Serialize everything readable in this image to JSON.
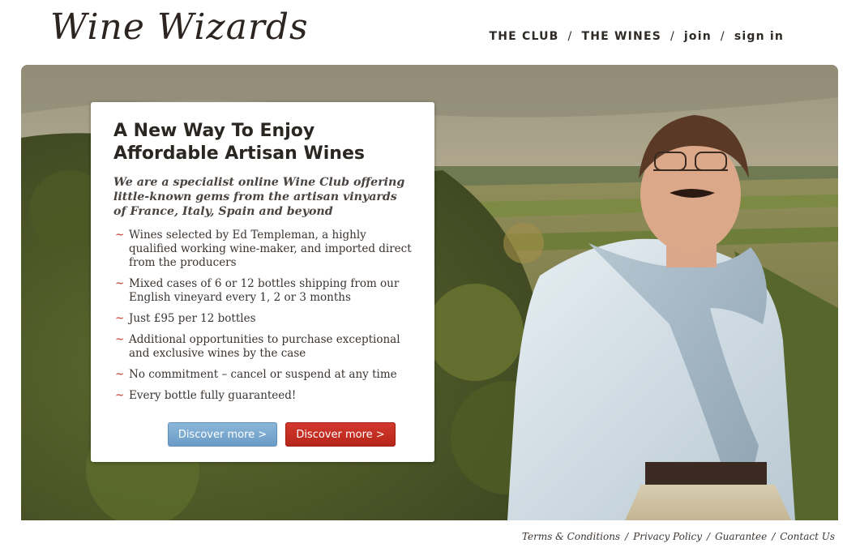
{
  "brand": {
    "logo_text": "Wine Wizards"
  },
  "nav": {
    "items": [
      {
        "label": "THE CLUB"
      },
      {
        "label": "THE WINES"
      },
      {
        "label": "join"
      },
      {
        "label": "sign in"
      }
    ],
    "separator": "/"
  },
  "hero": {
    "title_line1": "A New Way To Enjoy",
    "title_line2": "Affordable Artisan Wines",
    "intro": "We are a specialist online Wine Club offering little-known gems from the artisan vinyards of France, Italy, Spain and beyond",
    "bullet_marker": "~",
    "bullets": [
      "Wines selected by Ed Templeman, a highly qualified working wine-maker, and imported direct from the producers",
      "Mixed cases of 6 or 12 bottles shipping from our English vineyard every 1, 2 or 3 months",
      "Just £95 per 12 bottles",
      "Additional opportunities to purchase exceptional and exclusive wines by the case",
      "No commitment – cancel or suspend at any time",
      "Every bottle fully guaranteed!"
    ],
    "button_primary": "Discover more >",
    "button_secondary": "Discover more >"
  },
  "footer": {
    "links": [
      {
        "label": "Terms & Conditions"
      },
      {
        "label": "Privacy Policy"
      },
      {
        "label": "Guarantee"
      },
      {
        "label": "Contact Us"
      }
    ],
    "separator": "/"
  },
  "colors": {
    "accent_red": "#c0392b",
    "button_blue": "#7aa8cf",
    "button_red": "#c42f23",
    "text_dark": "#2a2622"
  }
}
